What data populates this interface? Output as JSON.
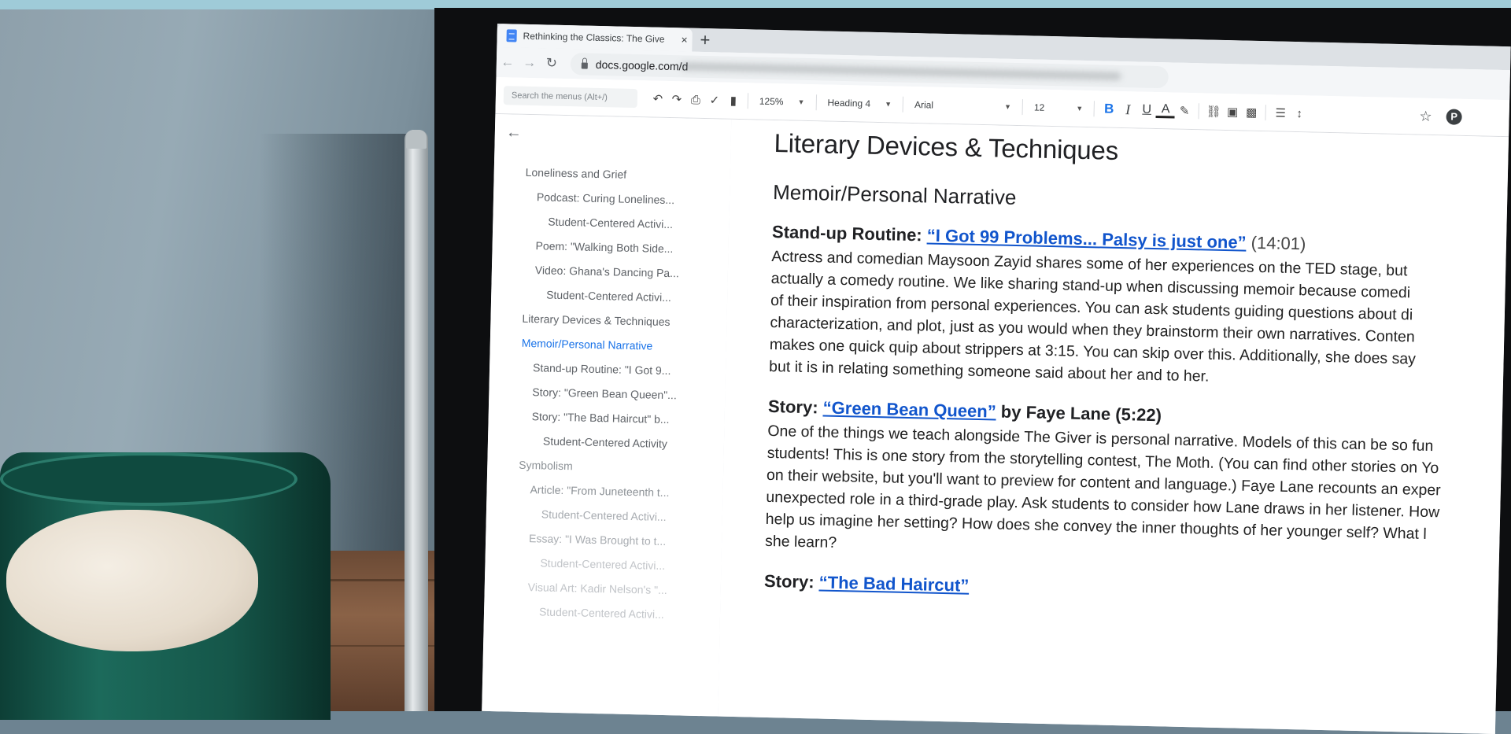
{
  "browser": {
    "tab_title": "Rethinking the Classics: The Give",
    "tab_close": "×",
    "new_tab": "+",
    "url": "docs.google.com/d"
  },
  "toolbar": {
    "search_placeholder": "Search the menus (Alt+/)",
    "zoom": "125%",
    "style": "Heading 4",
    "font": "Arial",
    "size": "12",
    "bold": "B",
    "italic": "I",
    "underline": "U",
    "text_color": "A",
    "pinterest": "P"
  },
  "outline": {
    "items": [
      {
        "label": "Loneliness and Grief",
        "level": 1
      },
      {
        "label": "Podcast: Curing Lonelines...",
        "level": 2
      },
      {
        "label": "Student-Centered Activi...",
        "level": 3
      },
      {
        "label": "Poem: \"Walking Both Side...",
        "level": 2
      },
      {
        "label": "Video: Ghana's Dancing Pa...",
        "level": 2
      },
      {
        "label": "Student-Centered Activi...",
        "level": 3
      },
      {
        "label": "Literary Devices & Techniques",
        "level": 1
      },
      {
        "label": "Memoir/Personal Narrative",
        "level": 1,
        "active": true
      },
      {
        "label": "Stand-up Routine: \"I Got 9...",
        "level": 2
      },
      {
        "label": "Story: \"Green Bean Queen\"...",
        "level": 2
      },
      {
        "label": "Story: \"The Bad Haircut\" b...",
        "level": 2
      },
      {
        "label": "Student-Centered Activity",
        "level": 3
      },
      {
        "label": "Symbolism",
        "level": 1
      },
      {
        "label": "Article: \"From Juneteenth t...",
        "level": 2
      },
      {
        "label": "Student-Centered Activi...",
        "level": 3
      },
      {
        "label": "Essay: \"I Was Brought to t...",
        "level": 2
      },
      {
        "label": "Student-Centered Activi...",
        "level": 3
      },
      {
        "label": "Visual Art: Kadir Nelson's \"...",
        "level": 2
      },
      {
        "label": "Student-Centered Activi...",
        "level": 3
      }
    ]
  },
  "document": {
    "title": "Literary Devices & Techniques",
    "subtitle": "Memoir/Personal Narrative",
    "sections": [
      {
        "prefix": "Stand-up Routine: ",
        "link": "“I Got 99 Problems... Palsy is just one”",
        "suffix": "",
        "duration": " (14:01)",
        "lines": [
          "Actress and comedian Maysoon Zayid shares some of her experiences on the TED stage, but",
          "actually a comedy routine. We like sharing stand-up when discussing memoir because comedi",
          "of their inspiration from personal experiences. You can ask students guiding questions about di",
          "characterization, and plot, just as you would when they brainstorm their own narratives. Conten",
          "makes one quick quip about strippers at 3:15. You can skip over this. Additionally, she does say",
          "but it is in relating something someone said about her and to her."
        ]
      },
      {
        "prefix": "Story: ",
        "link": "“Green Bean Queen”",
        "suffix": " by Faye Lane (5:22)",
        "duration": "",
        "lines": [
          "One of the things we teach alongside The Giver is personal narrative. Models of this can be so fun",
          "students! This is one story from the storytelling contest, The Moth. (You can find other stories on Yo",
          "on their website, but you'll want to preview for content and language.) Faye Lane recounts an exper",
          "unexpected role in a third-grade play. Ask students to consider how Lane draws in her listener. How",
          "help us imagine her setting? How does she convey the inner thoughts of her younger self? What l",
          "she learn?"
        ]
      },
      {
        "prefix": "Story: ",
        "link": "“The Bad Haircut”",
        "suffix": "",
        "duration": "",
        "lines": []
      }
    ]
  }
}
